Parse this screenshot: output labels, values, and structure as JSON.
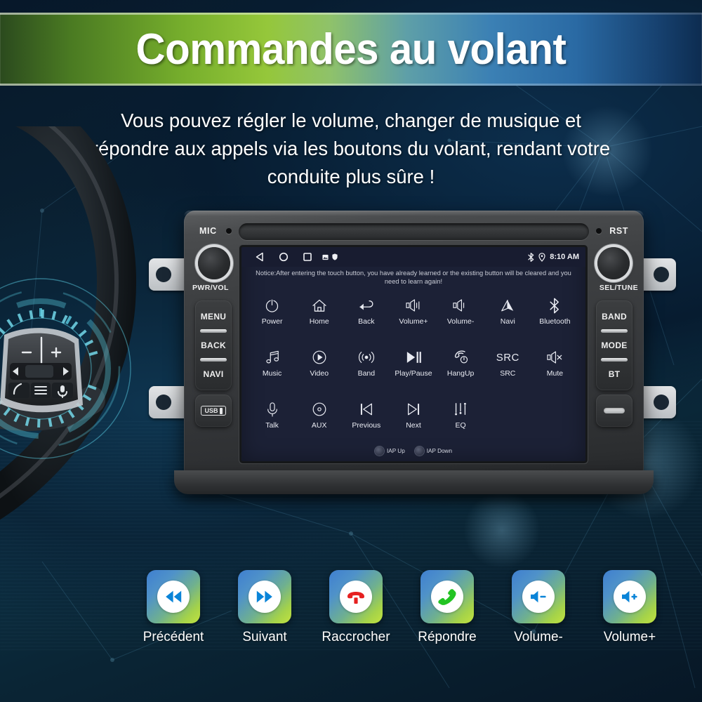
{
  "banner": {
    "title": "Commandes au volant"
  },
  "subtitle": {
    "line1": "Vous pouvez régler le volume, changer de musique et",
    "line2": "répondre aux appels via les boutons du volant, rendant votre",
    "line3": "conduite plus sûre !"
  },
  "colors": {
    "banner_green": "#95c73a",
    "banner_blue": "#2a6aa4",
    "background": "#0a2132",
    "screen_bg": "#1c2136",
    "tile_gradient_start": "#3f7fd0",
    "tile_gradient_end": "#c2e23f",
    "accent_red": "#e62020",
    "accent_green": "#23c423",
    "accent_blue": "#0a84d8"
  },
  "head_unit": {
    "mic_label": "MIC",
    "rst_label": "RST",
    "left_knob_label": "PWR/VOL",
    "right_knob_label": "SEL/TUNE",
    "left_buttons": [
      "MENU",
      "BACK",
      "NAVI"
    ],
    "right_buttons": [
      "BAND",
      "MODE",
      "BT"
    ],
    "left_extra_label": "USB",
    "right_extra_label": "card-slot"
  },
  "screen": {
    "statusbar": {
      "nav_icons": [
        "back-triangle-icon",
        "home-circle-icon",
        "recents-square-icon"
      ],
      "tray_icons": [
        "image-icon",
        "shield-icon"
      ],
      "right_icons": [
        "bluetooth-icon",
        "location-pin-icon"
      ],
      "time": "8:10 AM"
    },
    "notice": "Notice:After entering the touch button, you have already learned or the existing button will be cleared and you need to learn again!",
    "buttons": [
      [
        {
          "label": "Power",
          "icon": "power-icon"
        },
        {
          "label": "Home",
          "icon": "home-icon"
        },
        {
          "label": "Back",
          "icon": "back-arrow-icon"
        },
        {
          "label": "Volume+",
          "icon": "volume-up-icon"
        },
        {
          "label": "Volume-",
          "icon": "volume-down-icon"
        },
        {
          "label": "Navi",
          "icon": "navigation-arrow-icon"
        },
        {
          "label": "Bluetooth",
          "icon": "bluetooth-icon"
        }
      ],
      [
        {
          "label": "Music",
          "icon": "music-note-icon"
        },
        {
          "label": "Video",
          "icon": "play-circle-icon"
        },
        {
          "label": "Band",
          "icon": "radio-wave-icon"
        },
        {
          "label": "Play/Pause",
          "icon": "play-pause-icon"
        },
        {
          "label": "HangUp",
          "icon": "hangup-phone-icon"
        },
        {
          "label": "SRC",
          "icon": "src-text-icon",
          "icon_text": "SRC"
        },
        {
          "label": "Mute",
          "icon": "mute-icon"
        }
      ],
      [
        {
          "label": "Talk",
          "icon": "microphone-icon"
        },
        {
          "label": "AUX",
          "icon": "aux-disc-icon"
        },
        {
          "label": "Previous",
          "icon": "previous-track-icon"
        },
        {
          "label": "Next",
          "icon": "next-track-icon"
        },
        {
          "label": "EQ",
          "icon": "equalizer-icon"
        }
      ]
    ],
    "iap": [
      {
        "label": "IAP Up"
      },
      {
        "label": "IAP Down"
      }
    ]
  },
  "tiles": [
    {
      "label": "Précédent",
      "icon": "rewind-icon",
      "icon_color": "#0a84d8"
    },
    {
      "label": "Suivant",
      "icon": "fast-forward-icon",
      "icon_color": "#0a84d8"
    },
    {
      "label": "Raccrocher",
      "icon": "hangup-phone-icon",
      "icon_color": "#e62020"
    },
    {
      "label": "Répondre",
      "icon": "answer-phone-icon",
      "icon_color": "#23c423"
    },
    {
      "label": "Volume-",
      "icon": "volume-down-icon",
      "icon_color": "#0a84d8"
    },
    {
      "label": "Volume+",
      "icon": "volume-up-icon",
      "icon_color": "#0a84d8"
    }
  ]
}
